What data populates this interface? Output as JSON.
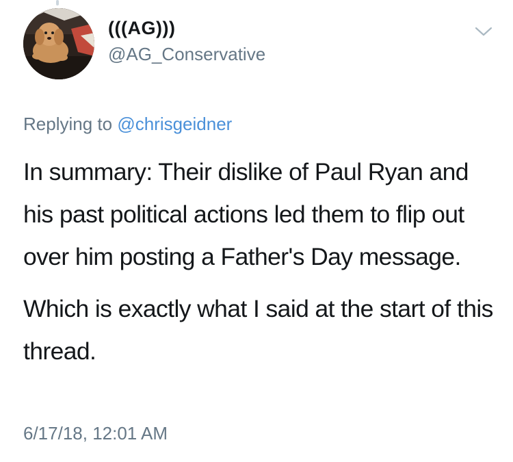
{
  "tweet": {
    "author": {
      "display_name": "(((AG)))",
      "handle": "@AG_Conservative",
      "avatar": "avatar-dog-on-couch"
    },
    "menu_icon": "chevron-down-icon",
    "replying_prefix": "Replying to",
    "replying_to": "@chrisgeidner",
    "paragraphs": [
      "In summary: Their dislike of Paul Ryan and his past political actions led them to flip out over him posting a Father's Day message.",
      "Which is exactly what I said at the start of this thread."
    ],
    "timestamp": "6/17/18, 12:01 AM"
  },
  "colors": {
    "text": "#14171a",
    "muted": "#657786",
    "link": "#4a90d9",
    "thread_line": "#ccd6dd"
  }
}
